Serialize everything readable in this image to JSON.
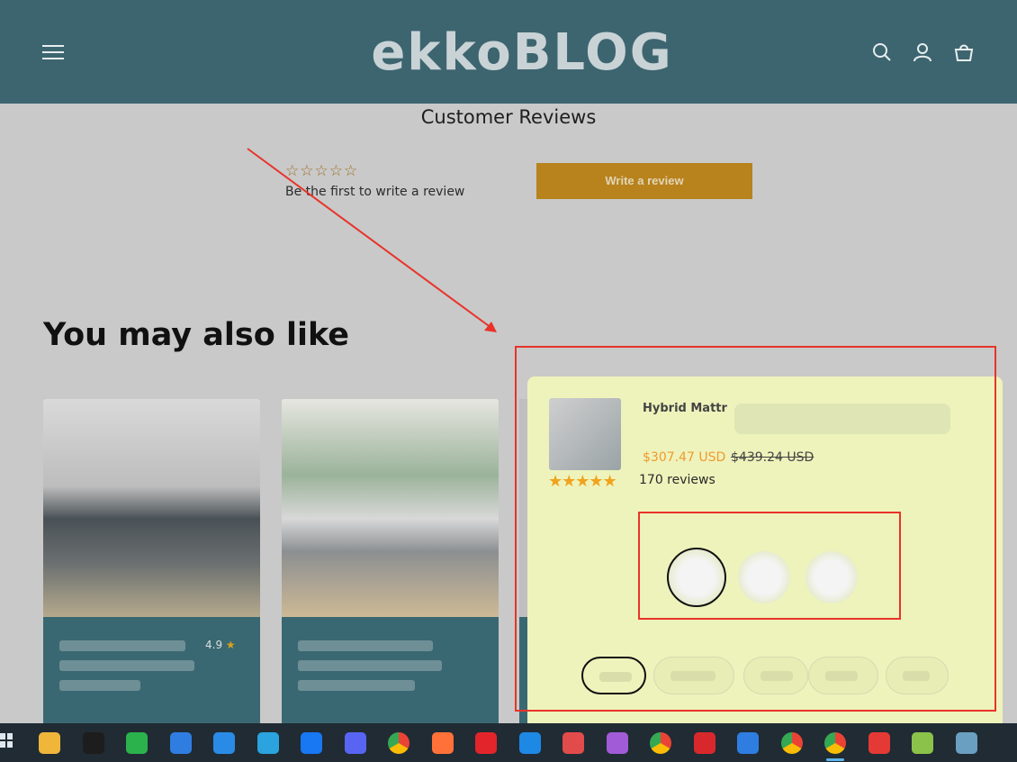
{
  "header": {
    "logo_text": "ekkoBLOG",
    "menu_icon": "hamburger-icon",
    "icons": [
      "search-icon",
      "account-icon",
      "cart-icon"
    ],
    "bg_color": "#3d6570"
  },
  "reviews": {
    "title": "Customer Reviews",
    "empty_stars": "☆☆☆☆☆",
    "first_review_text": "Be the first to write a review",
    "write_button": "Write a review"
  },
  "recommend": {
    "title": "You may also like",
    "card1_rating": "4.9",
    "card1_star": "★"
  },
  "popup": {
    "product_title": "Hybrid Mattr",
    "price_sale": "$307.47 USD",
    "price_original": "$439.24 USD",
    "stars": "★★★★★",
    "reviews_count": "170 reviews",
    "bg_color": "#eef3bb"
  },
  "annotation_color": "#e8332a",
  "taskbar": {
    "apps": [
      "file-explorer-icon",
      "qq-icon",
      "wechat-icon",
      "feishu-icon",
      "browser-icon",
      "telegram-icon",
      "facebook-icon",
      "discord-icon",
      "chrome-icon",
      "firefox-icon",
      "netease-icon",
      "edge-icon",
      "music-icon",
      "cat-icon",
      "chrome-icon",
      "wps-icon",
      "feishu-icon",
      "chrome-icon",
      "chrome-icon",
      "color-icon",
      "notes-icon",
      "monitor-icon"
    ]
  }
}
